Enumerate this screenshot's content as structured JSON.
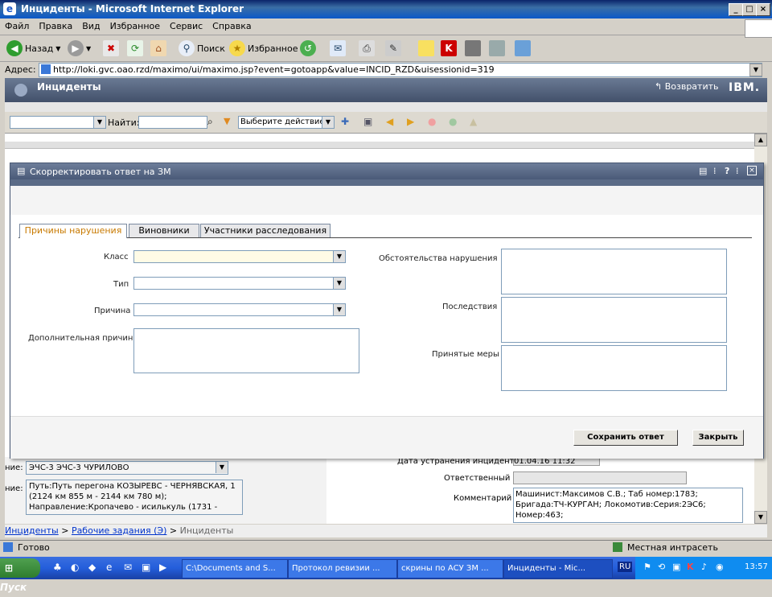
{
  "window": {
    "title": "Инциденты - Microsoft Internet Explorer"
  },
  "menu": [
    "Файл",
    "Правка",
    "Вид",
    "Избранное",
    "Сервис",
    "Справка"
  ],
  "toolbar": {
    "back": "Назад",
    "search": "Поиск",
    "favorites": "Избранное"
  },
  "address": {
    "label": "Адрес:",
    "url": "http://loki.gvc.oao.rzd/maximo/ui/maximo.jsp?event=gotoapp&value=INCID_RZD&uisessionid=319"
  },
  "maximo": {
    "app_title": "Инциденты",
    "return_label": "Возвратить",
    "brand": "IBM."
  },
  "mx_toolbar": {
    "find_label": "Найти:",
    "action_select": "Выберите действие"
  },
  "dialog": {
    "title": "Скорректировать ответ на ЗМ",
    "tabs": [
      "Причины нарушения",
      "Виновники",
      "Участники расследования"
    ],
    "fields": {
      "class": "Класс",
      "type": "Тип",
      "reason": "Причина",
      "extra_reason": "Дополнительная причина",
      "circumstances": "Обстоятельства нарушения",
      "consequences": "Последствия",
      "measures": "Принятые меры"
    },
    "buttons": {
      "save": "Сохранить ответ",
      "close": "Закрыть"
    }
  },
  "background": {
    "label1": "ние:",
    "label2": "ние:",
    "org_value": "ЭЧС-3 ЭЧС-3 ЧУРИЛОВО",
    "path_value": "Путь:Путь перегона КОЗЫРЕВС - ЧЕРНЯВСКАЯ, 1 (2124 км 855 м - 2144 км 780 м); Направление:Кропачево - исилькуль (1731 -",
    "date_label": "Дата устранения инцидента",
    "date_value": "01.04.16 11:32",
    "responsible_label": "Ответственный",
    "comment_label": "Комментарий",
    "comment_value": "Машинист:Максимов С.В.; Таб номер:1783; Бригада:ТЧ-КУРГАН; Локомотив:Серия:2ЭС6; Номер:463;"
  },
  "breadcrumb": {
    "items": [
      "Инциденты",
      "Рабочие задания (Э)",
      "Инциденты"
    ]
  },
  "status": {
    "left": "Готово",
    "zone": "Местная интрасеть"
  },
  "taskbar": {
    "start": "Пуск",
    "tasks": [
      "C:\\Documents and S...",
      "Протокол ревизии ...",
      "скрины по АСУ ЗМ ...",
      "Инциденты - Mic..."
    ],
    "lang": "RU",
    "clock": "13:57"
  }
}
